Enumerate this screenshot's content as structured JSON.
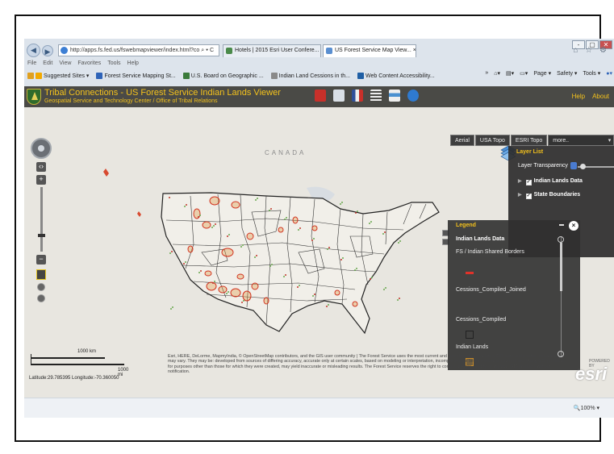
{
  "browser": {
    "window_buttons": [
      "-",
      "▢",
      "✕"
    ],
    "address": "http://apps.fs.fed.us/fswebmapviewer/index.html?co",
    "address_icons": "⌕ ▾ C",
    "tabs": [
      {
        "label": "Hotels | 2015 Esri User Confere...",
        "active": false
      },
      {
        "label": "US Forest Service Map View... ×",
        "active": true
      }
    ],
    "corner_icons": "⌂ ☆ ⚙",
    "menu": [
      "File",
      "Edit",
      "View",
      "Favorites",
      "Tools",
      "Help"
    ],
    "favorites": [
      "Suggested Sites ▾",
      "Forest Service Mapping St...",
      "U.S. Board on Geographic ...",
      "Indian Land Cessions in th...",
      "Web Content Accessibility..."
    ],
    "command_bar": [
      "»",
      "Page ▾",
      "Safety ▾",
      "Tools ▾"
    ],
    "zoom_level": "🔍100%  ▾"
  },
  "app": {
    "title": "Tribal Connections - US Forest Service Indian Lands Viewer",
    "subtitle": "Geospatial Service and Technology Center / Office of Tribal Relations",
    "links": [
      "Help",
      "About"
    ]
  },
  "map": {
    "country_label": "CANADA",
    "basemaps": [
      "Aerial",
      "USA Topo",
      "ESRI Topo",
      "more.."
    ],
    "zoom_in": "+",
    "zoom_out": "−",
    "scale_top": "1000 km",
    "scale_bottom": "1000 mi",
    "coordinates": "Latitude:29.785395   Longitude:-70.360050",
    "attribution": "Esri, HERE, DeLorme, MapmyIndia, © OpenStreetMap contributors, and the GIS user community  |  The Forest Service uses the most current and complete data available. GIS data and product accuracy may vary. They may be: developed from sources of differing accuracy, accurate only at certain scales, based on modeling or interpretation, incomplete while being created or revised, etc. Using GIS products for purposes other than those for which they were created, may yield inaccurate or misleading results. The Forest Service reserves the right to correct, update, modify, or replace, GIS products without notification.",
    "logo": "esri",
    "logo_caption": "POWERED BY"
  },
  "layer_list": {
    "title": "Layer List",
    "transparency_label": "Layer Transparency",
    "layers": [
      {
        "name": "Indian Lands Data",
        "checked": true
      },
      {
        "name": "State Boundaries",
        "checked": true
      }
    ]
  },
  "legend": {
    "title": "Legend",
    "group": "Indian Lands Data",
    "items": [
      {
        "label": "FS / Indian Shared Borders",
        "swatch": "#e0322a"
      },
      {
        "label": "Cessions_Compiled_Joined",
        "swatch": ""
      },
      {
        "label": "Cessions_Compiled",
        "swatch": "#222222"
      },
      {
        "label": "Indian Lands",
        "swatch": "#c78b2a"
      }
    ],
    "close": "×"
  },
  "colors": {
    "header_bg": "#4a4a46",
    "accent": "#f4c21c",
    "map_bg": "#e8e6e0",
    "indian_lands": "#c78b2a",
    "shared_borders": "#e0322a"
  }
}
